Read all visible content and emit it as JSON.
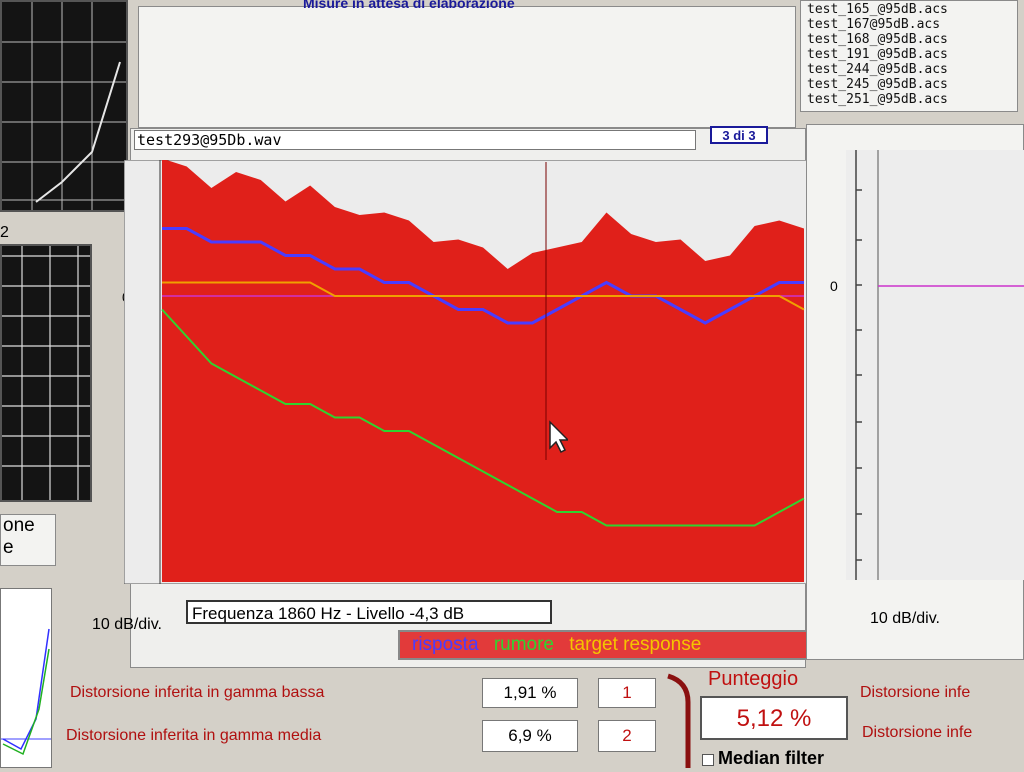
{
  "header": {
    "title_partial": "Misure in attesa di elaborazione"
  },
  "file_list": [
    "test_165_@95dB.acs",
    "test_167@95dB.acs",
    "test_168_@95dB.acs",
    "test_191_@95dB.acs",
    "test_244_@95dB.acs",
    "test_245_@95dB.acs",
    "test_251_@95dB.acs"
  ],
  "left_partial": {
    "num": "2",
    "one": "one",
    "e": "e"
  },
  "main": {
    "filename": "test293@95Db.wav",
    "page_indicator": "3 di 3",
    "scale_label": "10 dB/div.",
    "zero_label": "0",
    "status_readout": "Frequenza 1860 Hz - Livello -4,3 dB",
    "legend": [
      {
        "label": "risposta",
        "color": "#4a3cff"
      },
      {
        "label": "rumore",
        "color": "#2fd42f"
      },
      {
        "label": "target response",
        "color": "#f5c400"
      }
    ]
  },
  "right": {
    "scale_label": "10 dB/div.",
    "zero_label": "0"
  },
  "metrics": [
    {
      "label": "Distorsione inferita in gamma bassa",
      "value": "1,91 %",
      "index": "1"
    },
    {
      "label": "Distorsione inferita in gamma media",
      "value": "6,9 %",
      "index": "2"
    }
  ],
  "right_metrics": [
    "Distorsione infe",
    "Distorsione infe"
  ],
  "score": {
    "title": "Punteggio",
    "value": "5,12 %"
  },
  "median_filter": {
    "label": "Median filter"
  },
  "colors": {
    "plot_red": "#e0201a",
    "accent_blue": "#1a1a9a",
    "score_red": "#c01010",
    "target_line": "#f0a000",
    "zero_line": "#cc33cc"
  },
  "chart_data": {
    "type": "area",
    "title": "test293@95Db.wav",
    "ylabel": "10 dB/div.",
    "grid": false,
    "series": [
      {
        "name": "risposta",
        "values": [
          5,
          5,
          4,
          4,
          4,
          3,
          3,
          2,
          2,
          1,
          1,
          0,
          -1,
          -1,
          -2,
          -2,
          -1,
          0,
          1,
          0,
          0,
          -1,
          -2,
          -1,
          0,
          1,
          1
        ]
      },
      {
        "name": "rumore",
        "values": [
          -1,
          -3,
          -5,
          -6,
          -7,
          -8,
          -8,
          -9,
          -9,
          -10,
          -10,
          -11,
          -12,
          -13,
          -14,
          -15,
          -16,
          -16,
          -17,
          -17,
          -17,
          -17,
          -17,
          -17,
          -17,
          -16,
          -15
        ]
      },
      {
        "name": "target response",
        "values": [
          1,
          1,
          1,
          1,
          1,
          1,
          1,
          0,
          0,
          0,
          0,
          0,
          0,
          0,
          0,
          0,
          0,
          0,
          0,
          0,
          0,
          0,
          0,
          0,
          0,
          0,
          -1
        ]
      }
    ]
  }
}
